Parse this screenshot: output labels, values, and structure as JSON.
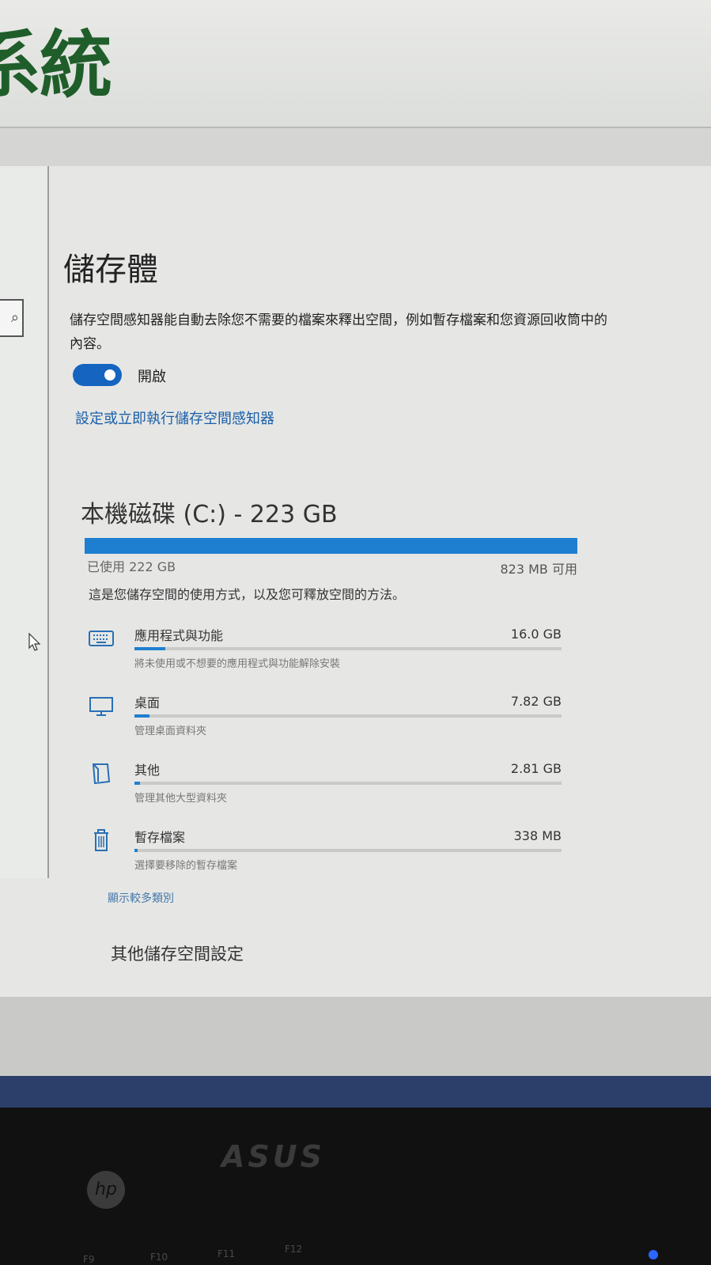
{
  "background_window": {
    "title": "系統"
  },
  "storage": {
    "title": "儲存體",
    "description": "儲存空間感知器能自動去除您不需要的檔案來釋出空間，例如暫存檔案和您資源回收筒中的內容。",
    "toggle": {
      "state_label": "開啟",
      "on": true
    },
    "configure_link": "設定或立即執行儲存空間感知器",
    "drive": {
      "title": "本機磁碟 (C:) - 223 GB",
      "used_label": "已使用 222 GB",
      "free_label": "823 MB 可用",
      "used_fraction": 0.996
    },
    "usage_desc": "這是您儲存空間的使用方式，以及您可釋放空間的方法。",
    "categories": [
      {
        "name": "應用程式與功能",
        "size": "16.0 GB",
        "sub": "將未使用或不想要的應用程式與功能解除安裝",
        "fraction": 0.072,
        "icon": "keyboard-icon"
      },
      {
        "name": "桌面",
        "size": "7.82 GB",
        "sub": "管理桌面資料夾",
        "fraction": 0.035,
        "icon": "monitor-icon"
      },
      {
        "name": "其他",
        "size": "2.81 GB",
        "sub": "管理其他大型資料夾",
        "fraction": 0.013,
        "icon": "folder-icon"
      },
      {
        "name": "暫存檔案",
        "size": "338 MB",
        "sub": "選擇要移除的暫存檔案",
        "fraction": 0.002,
        "icon": "trash-icon"
      }
    ],
    "show_more": "顯示較多類別",
    "other_settings": "其他儲存空間設定"
  },
  "laptop": {
    "brand_text": "ASUS",
    "hp_logo": "hp",
    "fkeys": [
      "F9",
      "F10",
      "F11",
      "F12"
    ]
  },
  "colors": {
    "accent": "#1e7fd0",
    "link": "#1a5fa8",
    "toggle": "#1565c0"
  }
}
